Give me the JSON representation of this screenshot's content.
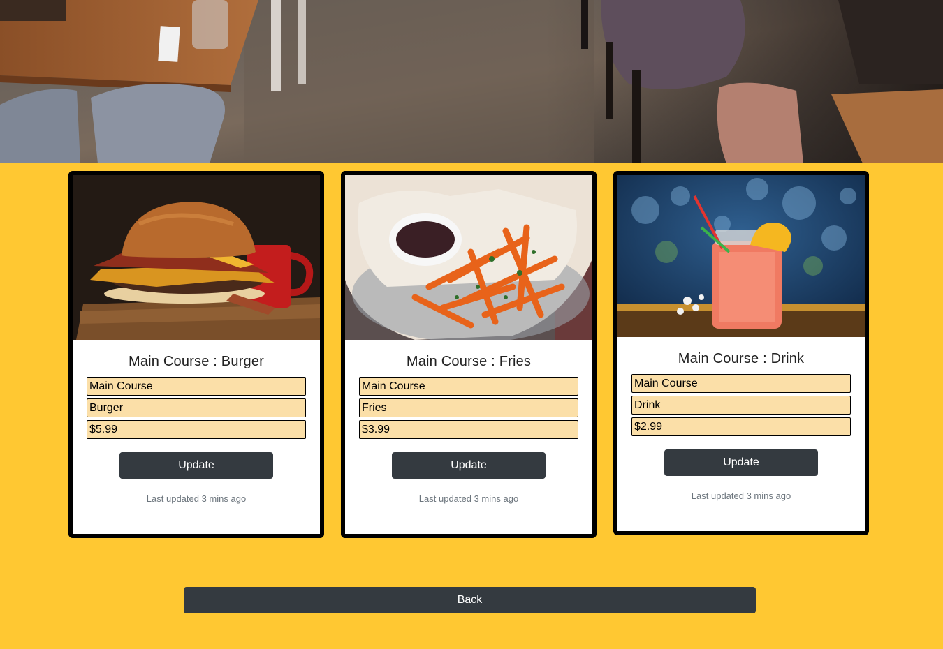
{
  "hero": {
    "image": "restaurant-interior-photo"
  },
  "cards": [
    {
      "image": "burger-photo",
      "title": "Main Course : Burger",
      "category_value": "Main Course",
      "name_value": "Burger",
      "price_value": "$5.99",
      "update_label": "Update",
      "updated_text": "Last updated 3 mins ago"
    },
    {
      "image": "fries-photo",
      "title": "Main Course : Fries",
      "category_value": "Main Course",
      "name_value": "Fries",
      "price_value": "$3.99",
      "update_label": "Update",
      "updated_text": "Last updated 3 mins ago"
    },
    {
      "image": "drink-photo",
      "title": "Main Course : Drink",
      "category_value": "Main Course",
      "name_value": "Drink",
      "price_value": "$2.99",
      "update_label": "Update",
      "updated_text": "Last updated 3 mins ago"
    }
  ],
  "back_label": "Back",
  "colors": {
    "page_background": "#ffc832",
    "field_background": "#fbdfa8",
    "button_background": "#343a40",
    "muted_text": "#6c757d"
  }
}
